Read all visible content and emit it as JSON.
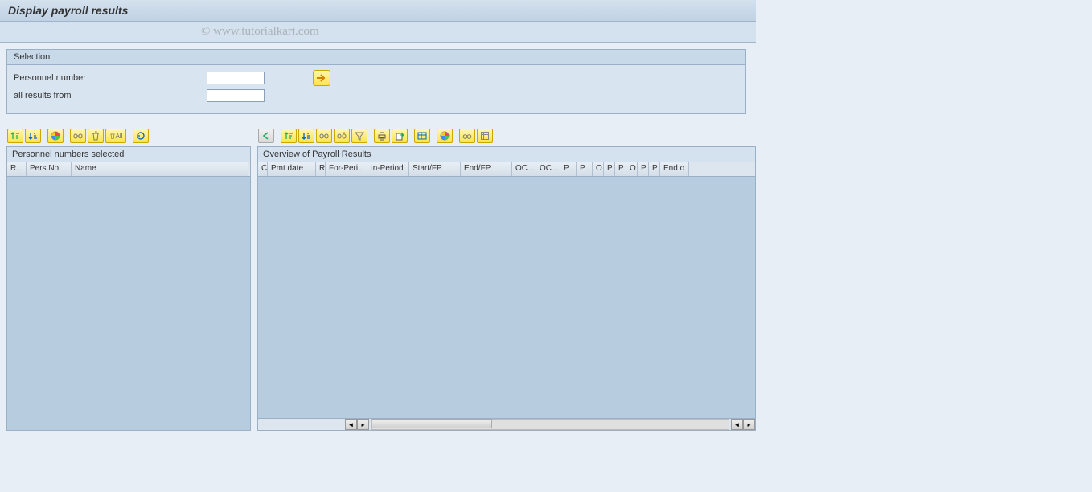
{
  "title": "Display payroll results",
  "watermark": "© www.tutorialkart.com",
  "selection": {
    "header": "Selection",
    "personnel_label": "Personnel number",
    "personnel_value": "",
    "all_results_label": "all results from",
    "all_results_value": ""
  },
  "left_pane": {
    "header": "Personnel numbers selected",
    "columns": {
      "c1": "R..",
      "c2": "Pers.No.",
      "c3": "Name"
    }
  },
  "right_pane": {
    "header": "Overview of Payroll Results",
    "columns": {
      "c1": "C",
      "c2": "Pmt date",
      "c3": "R",
      "c4": "For-Peri..",
      "c5": "In-Period",
      "c6": "Start/FP",
      "c7": "End/FP",
      "c8": "OC ..",
      "c9": "OC ..",
      "c10": "P..",
      "c11": "P..",
      "c12": "O",
      "c13": "P",
      "c14": "P",
      "c15": "O",
      "c16": "P",
      "c17": "P",
      "c18": "End o"
    }
  },
  "toolbar_left": {
    "all_label": "All"
  }
}
